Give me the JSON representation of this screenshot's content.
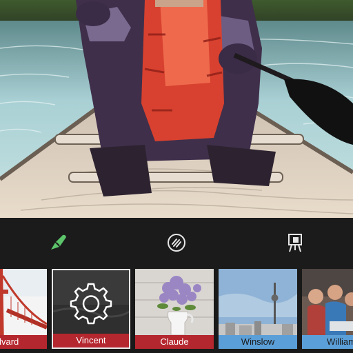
{
  "photo": {
    "description_icon": "painted-photo"
  },
  "toolbar": {
    "tools": [
      {
        "icon": "brush-icon",
        "color": "#5cc46a"
      },
      {
        "icon": "intensity-icon",
        "color": "#e6e6e6"
      },
      {
        "icon": "easel-icon",
        "color": "#e6e6e6"
      }
    ]
  },
  "styles": {
    "items": [
      {
        "label": "dvard",
        "label_color": "#b5272f"
      },
      {
        "label": "Vincent",
        "label_color": "#b5272f",
        "selected": true,
        "overlay_icon": "gear-icon"
      },
      {
        "label": "Claude",
        "label_color": "#b5272f"
      },
      {
        "label": "Winslow",
        "label_color": "#5b9fd8"
      },
      {
        "label": "William",
        "label_color": "#5b9fd8"
      }
    ]
  }
}
